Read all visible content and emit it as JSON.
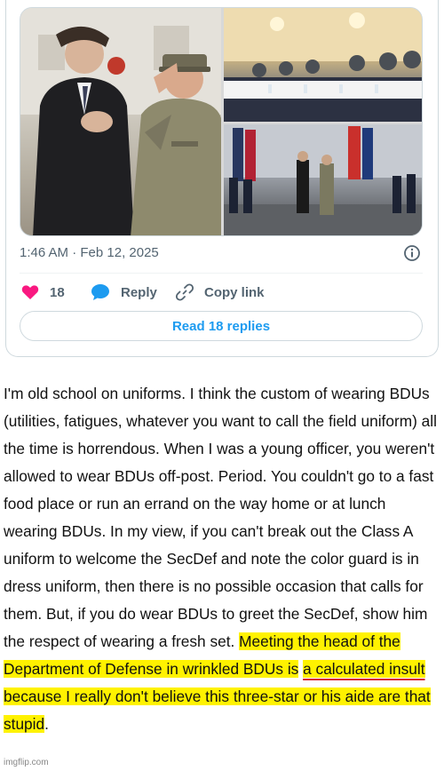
{
  "tweet": {
    "timestamp": "1:46 AM · Feb 12, 2025",
    "likes": "18",
    "reply_label": "Reply",
    "copy_link_label": "Copy link",
    "read_replies_label": "Read 18 replies",
    "colors": {
      "like": "#f91880",
      "link": "#1d9bf0",
      "muted": "#536471"
    },
    "icons": [
      "info-icon",
      "heart-icon",
      "reply-icon",
      "link-icon"
    ]
  },
  "article": {
    "plain": "I'm old school on uniforms. I think the custom of wearing BDUs (utilities, fatigues, whatever you want to call the field uniform) all the time is horrendous. When I was a young officer, you weren't allowed to wear BDUs off-post. Period. You couldn't go to a fast food place or run an errand on the way home or at lunch wearing BDUs. In my view, if you can't break out the Class A uniform to welcome the SecDef and note the color guard is in dress uniform, then there is no possible occasion that calls for them. But, if you do wear BDUs to greet the SecDef, show him the respect of wearing a fresh set.",
    "highlight_1": "Meeting the head of the Department of Defense in wrinkled BDUs is",
    "highlight_underlined": "a calculated insult",
    "highlight_2": "because I really don't believe this three-star or his aide are that stupid",
    "end_punct": ".",
    "highlight_color": "#fff200",
    "underline_color": "#d7192a"
  },
  "watermark": "imgflip.com"
}
